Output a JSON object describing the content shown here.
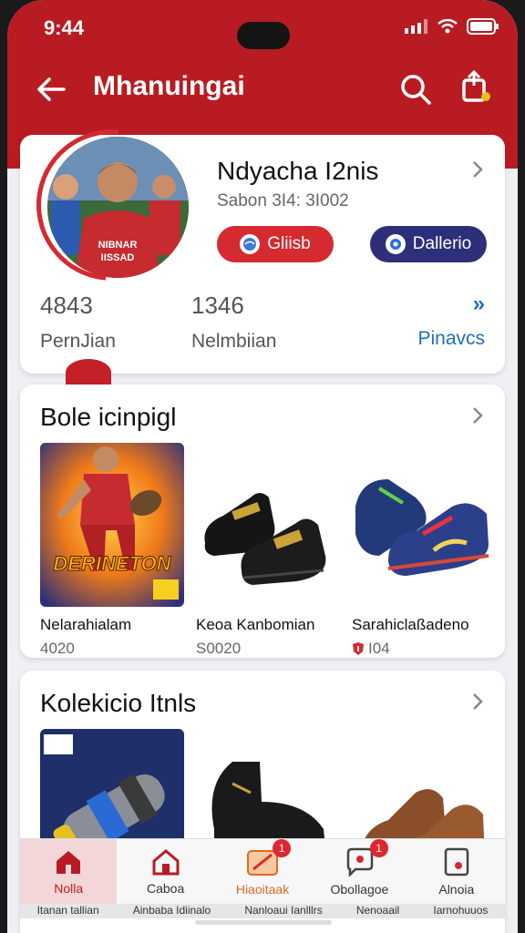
{
  "status": {
    "time": "9:44"
  },
  "appbar": {
    "title": "Mhanuingai"
  },
  "profile": {
    "name": "Ndyacha I2nis",
    "subtitle": "Sabon 3I4: 3I002",
    "button_red": "Gliisb",
    "button_blue": "Dallerio",
    "stats": [
      {
        "value": "4843",
        "label": "PernJian"
      },
      {
        "value": "1346",
        "label": "Nelmbiian"
      }
    ],
    "more": {
      "arrows": "»",
      "label": "Pinavcs"
    }
  },
  "section1": {
    "title": "Bole icinpigl",
    "items": [
      {
        "name": "Nelarahialam",
        "price": "4020",
        "thumb_text": "DERINETON"
      },
      {
        "name": "Keoa Kanbomian",
        "price": "S0020"
      },
      {
        "name": "Sarahiclaßadeno",
        "price": "I04"
      }
    ]
  },
  "section2": {
    "title": "Kolekicio Itnls"
  },
  "nav": {
    "items": [
      {
        "label": "Nolla",
        "icon": "home-icon",
        "badge": ""
      },
      {
        "label": "Caboa",
        "icon": "store-icon",
        "badge": ""
      },
      {
        "label": "Hiaoitaak",
        "icon": "ticket-icon",
        "badge": "1"
      },
      {
        "label": "Obollagoe",
        "icon": "chat-icon",
        "badge": "1"
      },
      {
        "label": "Alnoia",
        "icon": "profile-card-icon",
        "badge": ""
      }
    ]
  },
  "underbar": [
    "Itanan tallian",
    "Ainbaba Idiinalo",
    "Nanloaui Ianlllrs",
    "Nenoaail",
    "Iarnohuuos"
  ],
  "colors": {
    "brand": "#b81c22",
    "blue": "#2e2f7a",
    "link": "#1f6fbd"
  }
}
